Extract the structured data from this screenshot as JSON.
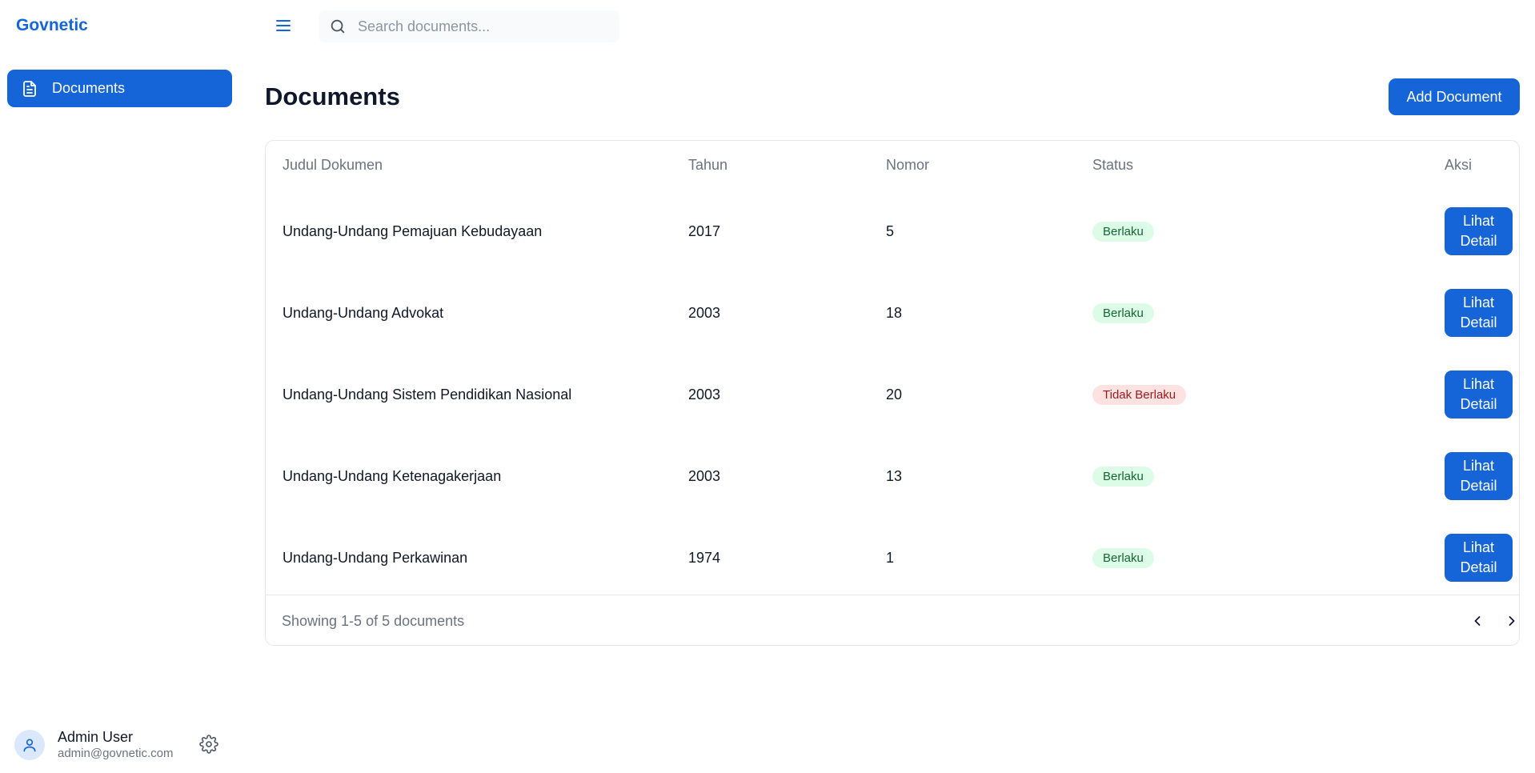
{
  "app": {
    "brand": "Govnetic"
  },
  "sidebar": {
    "items": [
      {
        "label": "Documents",
        "icon": "document-icon",
        "active": true
      }
    ],
    "user": {
      "name": "Admin User",
      "email": "admin@govnetic.com"
    }
  },
  "topbar": {
    "search_placeholder": "Search documents..."
  },
  "main": {
    "title": "Documents",
    "add_button": "Add Document",
    "table": {
      "headers": [
        "Judul Dokumen",
        "Tahun",
        "Nomor",
        "Status",
        "Aksi"
      ],
      "rows": [
        {
          "title": "Undang-Undang Pemajuan Kebudayaan",
          "year": "2017",
          "number": "5",
          "status": "Berlaku",
          "action": "Lihat Detail"
        },
        {
          "title": "Undang-Undang Advokat",
          "year": "2003",
          "number": "18",
          "status": "Berlaku",
          "action": "Lihat Detail"
        },
        {
          "title": "Undang-Undang Sistem Pendidikan Nasional",
          "year": "2003",
          "number": "20",
          "status": "Tidak Berlaku",
          "action": "Lihat Detail"
        },
        {
          "title": "Undang-Undang Ketenagakerjaan",
          "year": "2003",
          "number": "13",
          "status": "Berlaku",
          "action": "Lihat Detail"
        },
        {
          "title": "Undang-Undang Perkawinan",
          "year": "1974",
          "number": "1",
          "status": "Berlaku",
          "action": "Lihat Detail"
        }
      ]
    },
    "footer": {
      "summary": "Showing 1-5 of 5 documents"
    }
  },
  "colors": {
    "primary": "#1565d8",
    "status_active_bg": "#dcfce7",
    "status_active_text": "#166534",
    "status_inactive_bg": "#fee2e2",
    "status_inactive_text": "#991b1b"
  }
}
